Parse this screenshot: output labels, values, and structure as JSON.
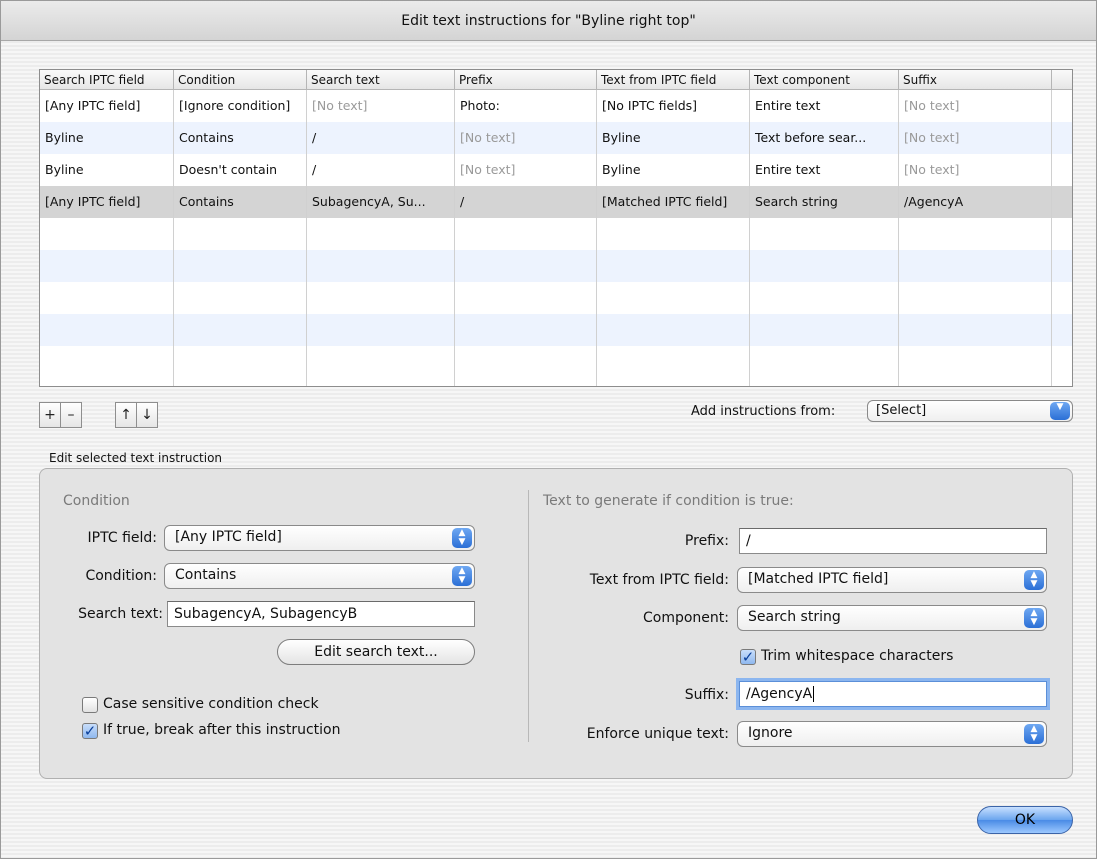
{
  "window": {
    "title": "Edit text instructions for \"Byline right top\""
  },
  "table": {
    "columns": [
      "Search IPTC field",
      "Condition",
      "Search text",
      "Prefix",
      "Text from IPTC field",
      "Text component",
      "Suffix"
    ],
    "rows": [
      [
        "[Any IPTC field]",
        "[Ignore condition]",
        "[No text]",
        "Photo:",
        "[No IPTC fields]",
        "Entire text",
        "[No text]"
      ],
      [
        "Byline",
        "Contains",
        "/",
        "[No text]",
        "Byline",
        "Text before sear...",
        "[No text]"
      ],
      [
        "Byline",
        "Doesn't contain",
        "/",
        "[No text]",
        "Byline",
        "Entire text",
        "[No text]"
      ],
      [
        "[Any IPTC field]",
        "Contains",
        "SubagencyA, Su...",
        "/",
        "[Matched IPTC field]",
        "Search string",
        "/AgencyA"
      ]
    ],
    "selected_row": 3
  },
  "table_buttons": {
    "add": "+",
    "remove": "–",
    "move_up": "↑",
    "move_down": "↓"
  },
  "add_instructions": {
    "label": "Add instructions from:",
    "value": "[Select]"
  },
  "edit_section": {
    "title": "Edit selected text instruction"
  },
  "condition": {
    "heading": "Condition",
    "iptc_field_label": "IPTC field:",
    "iptc_field_value": "[Any IPTC field]",
    "condition_label": "Condition:",
    "condition_value": "Contains",
    "search_text_label": "Search text:",
    "search_text_value": "SubagencyA, SubagencyB",
    "edit_search_button": "Edit search text...",
    "case_sensitive_label": "Case sensitive condition check",
    "case_sensitive_checked": false,
    "break_label": "If true, break after this instruction",
    "break_checked": true
  },
  "generate": {
    "heading": "Text to generate if condition is true:",
    "prefix_label": "Prefix:",
    "prefix_value": "/",
    "text_from_label": "Text from IPTC field:",
    "text_from_value": "[Matched IPTC field]",
    "component_label": "Component:",
    "component_value": "Search string",
    "trim_label": "Trim whitespace characters",
    "trim_checked": true,
    "suffix_label": "Suffix:",
    "suffix_value": "/AgencyA",
    "enforce_label": "Enforce unique text:",
    "enforce_value": "Ignore"
  },
  "ok_button": "OK",
  "colors": {
    "accent": "#2b6fd6",
    "selected_row": "#d4d4d4",
    "alt_row": "#edf3fe"
  },
  "icons": {
    "popup_arrows": "up-down-arrows-icon",
    "dropdown": "chevron-down-icon",
    "checkmark": "checkmark-icon"
  }
}
